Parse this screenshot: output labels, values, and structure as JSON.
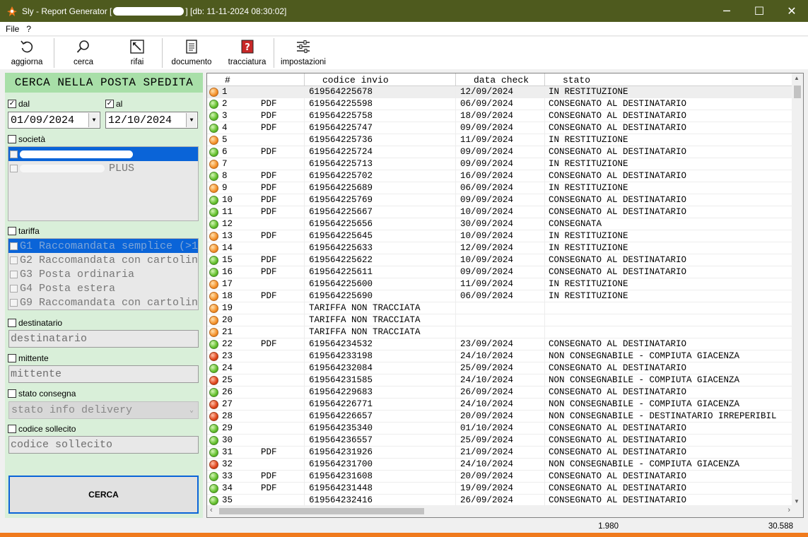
{
  "window": {
    "title_prefix": "Sly - Report Generator [",
    "title_suffix": "] [db: 11-11-2024 08:30:02]",
    "minimize": "─",
    "maximize": "☐",
    "close": "✕"
  },
  "menu": {
    "file": "File",
    "help": "?"
  },
  "toolbar": {
    "aggiorna": "aggiorna",
    "cerca": "cerca",
    "rifai": "rifai",
    "documento": "documento",
    "tracciatura": "tracciatura",
    "impostazioni": "impostazioni"
  },
  "filters": {
    "header": "CERCA NELLA POSTA SPEDITA",
    "dal_label": "dal",
    "dal_value": "01/09/2024",
    "al_label": "al",
    "al_value": "12/10/2024",
    "societa_label": "società",
    "societa_item2": "PLUS",
    "tariffa_label": "tariffa",
    "tariffe": [
      "G1 Raccomandata semplice (>1",
      "G2 Raccomandata con cartolin",
      "G3 Posta ordinaria",
      "G4 Posta estera",
      "G9 Raccomandata con cartolin"
    ],
    "destinatario_label": "destinatario",
    "destinatario_placeholder": "destinatario",
    "mittente_label": "mittente",
    "mittente_placeholder": "mittente",
    "stato_label": "stato consegna",
    "stato_placeholder": "stato info delivery",
    "sollecito_label": "codice sollecito",
    "sollecito_placeholder": "codice sollecito",
    "search_button": "CERCA"
  },
  "grid": {
    "columns": [
      "#",
      "codice invio",
      "data check",
      "stato"
    ],
    "status_colors": {
      "green": "#63c02c",
      "orange": "#f5912a",
      "red": "#e0441a"
    },
    "rows": [
      {
        "n": "1",
        "s": "orange",
        "pdf": "",
        "codice": "619564225678",
        "data": "12/09/2024",
        "stato": "IN RESTITUZIONE"
      },
      {
        "n": "2",
        "s": "green",
        "pdf": "PDF",
        "codice": "619564225598",
        "data": "06/09/2024",
        "stato": "CONSEGNATO AL DESTINATARIO"
      },
      {
        "n": "3",
        "s": "green",
        "pdf": "PDF",
        "codice": "619564225758",
        "data": "18/09/2024",
        "stato": "CONSEGNATO AL DESTINATARIO"
      },
      {
        "n": "4",
        "s": "green",
        "pdf": "PDF",
        "codice": "619564225747",
        "data": "09/09/2024",
        "stato": "CONSEGNATO AL DESTINATARIO"
      },
      {
        "n": "5",
        "s": "orange",
        "pdf": "",
        "codice": "619564225736",
        "data": "11/09/2024",
        "stato": "IN RESTITUZIONE"
      },
      {
        "n": "6",
        "s": "green",
        "pdf": "PDF",
        "codice": "619564225724",
        "data": "09/09/2024",
        "stato": "CONSEGNATO AL DESTINATARIO"
      },
      {
        "n": "7",
        "s": "orange",
        "pdf": "",
        "codice": "619564225713",
        "data": "09/09/2024",
        "stato": "IN RESTITUZIONE"
      },
      {
        "n": "8",
        "s": "green",
        "pdf": "PDF",
        "codice": "619564225702",
        "data": "16/09/2024",
        "stato": "CONSEGNATO AL DESTINATARIO"
      },
      {
        "n": "9",
        "s": "orange",
        "pdf": "PDF",
        "codice": "619564225689",
        "data": "06/09/2024",
        "stato": "IN RESTITUZIONE"
      },
      {
        "n": "10",
        "s": "green",
        "pdf": "PDF",
        "codice": "619564225769",
        "data": "09/09/2024",
        "stato": "CONSEGNATO AL DESTINATARIO"
      },
      {
        "n": "11",
        "s": "green",
        "pdf": "PDF",
        "codice": "619564225667",
        "data": "10/09/2024",
        "stato": "CONSEGNATO AL DESTINATARIO"
      },
      {
        "n": "12",
        "s": "green",
        "pdf": "",
        "codice": "619564225656",
        "data": "30/09/2024",
        "stato": "CONSEGNATA"
      },
      {
        "n": "13",
        "s": "orange",
        "pdf": "PDF",
        "codice": "619564225645",
        "data": "10/09/2024",
        "stato": "IN RESTITUZIONE"
      },
      {
        "n": "14",
        "s": "orange",
        "pdf": "",
        "codice": "619564225633",
        "data": "12/09/2024",
        "stato": "IN RESTITUZIONE"
      },
      {
        "n": "15",
        "s": "green",
        "pdf": "PDF",
        "codice": "619564225622",
        "data": "10/09/2024",
        "stato": "CONSEGNATO AL DESTINATARIO"
      },
      {
        "n": "16",
        "s": "green",
        "pdf": "PDF",
        "codice": "619564225611",
        "data": "09/09/2024",
        "stato": "CONSEGNATO AL DESTINATARIO"
      },
      {
        "n": "17",
        "s": "orange",
        "pdf": "",
        "codice": "619564225600",
        "data": "11/09/2024",
        "stato": "IN RESTITUZIONE"
      },
      {
        "n": "18",
        "s": "orange",
        "pdf": "PDF",
        "codice": "619564225690",
        "data": "06/09/2024",
        "stato": "IN RESTITUZIONE"
      },
      {
        "n": "19",
        "s": "orange",
        "pdf": "",
        "codice": "TARIFFA NON TRACCIATA",
        "data": "",
        "stato": ""
      },
      {
        "n": "20",
        "s": "orange",
        "pdf": "",
        "codice": "TARIFFA NON TRACCIATA",
        "data": "",
        "stato": ""
      },
      {
        "n": "21",
        "s": "orange",
        "pdf": "",
        "codice": "TARIFFA NON TRACCIATA",
        "data": "",
        "stato": ""
      },
      {
        "n": "22",
        "s": "green",
        "pdf": "PDF",
        "codice": "619564234532",
        "data": "23/09/2024",
        "stato": "CONSEGNATO AL DESTINATARIO"
      },
      {
        "n": "23",
        "s": "red",
        "pdf": "",
        "codice": "619564233198",
        "data": "24/10/2024",
        "stato": "NON CONSEGNABILE - COMPIUTA GIACENZA"
      },
      {
        "n": "24",
        "s": "green",
        "pdf": "",
        "codice": "619564232084",
        "data": "25/09/2024",
        "stato": "CONSEGNATO AL DESTINATARIO"
      },
      {
        "n": "25",
        "s": "red",
        "pdf": "",
        "codice": "619564231585",
        "data": "24/10/2024",
        "stato": "NON CONSEGNABILE - COMPIUTA GIACENZA"
      },
      {
        "n": "26",
        "s": "green",
        "pdf": "",
        "codice": "619564229683",
        "data": "26/09/2024",
        "stato": "CONSEGNATO AL DESTINATARIO"
      },
      {
        "n": "27",
        "s": "red",
        "pdf": "",
        "codice": "619564226771",
        "data": "24/10/2024",
        "stato": "NON CONSEGNABILE - COMPIUTA GIACENZA"
      },
      {
        "n": "28",
        "s": "red",
        "pdf": "",
        "codice": "619564226657",
        "data": "20/09/2024",
        "stato": "NON CONSEGNABILE - DESTINATARIO IRREPERIBIL"
      },
      {
        "n": "29",
        "s": "green",
        "pdf": "",
        "codice": "619564235340",
        "data": "01/10/2024",
        "stato": "CONSEGNATO AL DESTINATARIO"
      },
      {
        "n": "30",
        "s": "green",
        "pdf": "",
        "codice": "619564236557",
        "data": "25/09/2024",
        "stato": "CONSEGNATO AL DESTINATARIO"
      },
      {
        "n": "31",
        "s": "green",
        "pdf": "PDF",
        "codice": "619564231926",
        "data": "21/09/2024",
        "stato": "CONSEGNATO AL DESTINATARIO"
      },
      {
        "n": "32",
        "s": "red",
        "pdf": "",
        "codice": "619564231700",
        "data": "24/10/2024",
        "stato": "NON CONSEGNABILE - COMPIUTA GIACENZA"
      },
      {
        "n": "33",
        "s": "green",
        "pdf": "PDF",
        "codice": "619564231608",
        "data": "20/09/2024",
        "stato": "CONSEGNATO AL DESTINATARIO"
      },
      {
        "n": "34",
        "s": "green",
        "pdf": "PDF",
        "codice": "619564231448",
        "data": "19/09/2024",
        "stato": "CONSEGNATO AL DESTINATARIO"
      },
      {
        "n": "35",
        "s": "green",
        "pdf": "",
        "codice": "619564232416",
        "data": "26/09/2024",
        "stato": "CONSEGNATO AL DESTINATARIO"
      }
    ]
  },
  "status": {
    "count_selected": "1.980",
    "count_total": "30.588"
  },
  "accent": {
    "titlebar": "#4e5a1e",
    "selection": "#0a64d8",
    "panel": "#d9efd9",
    "header": "#a8dfa8",
    "bottom_bar": "#f07a1c"
  }
}
